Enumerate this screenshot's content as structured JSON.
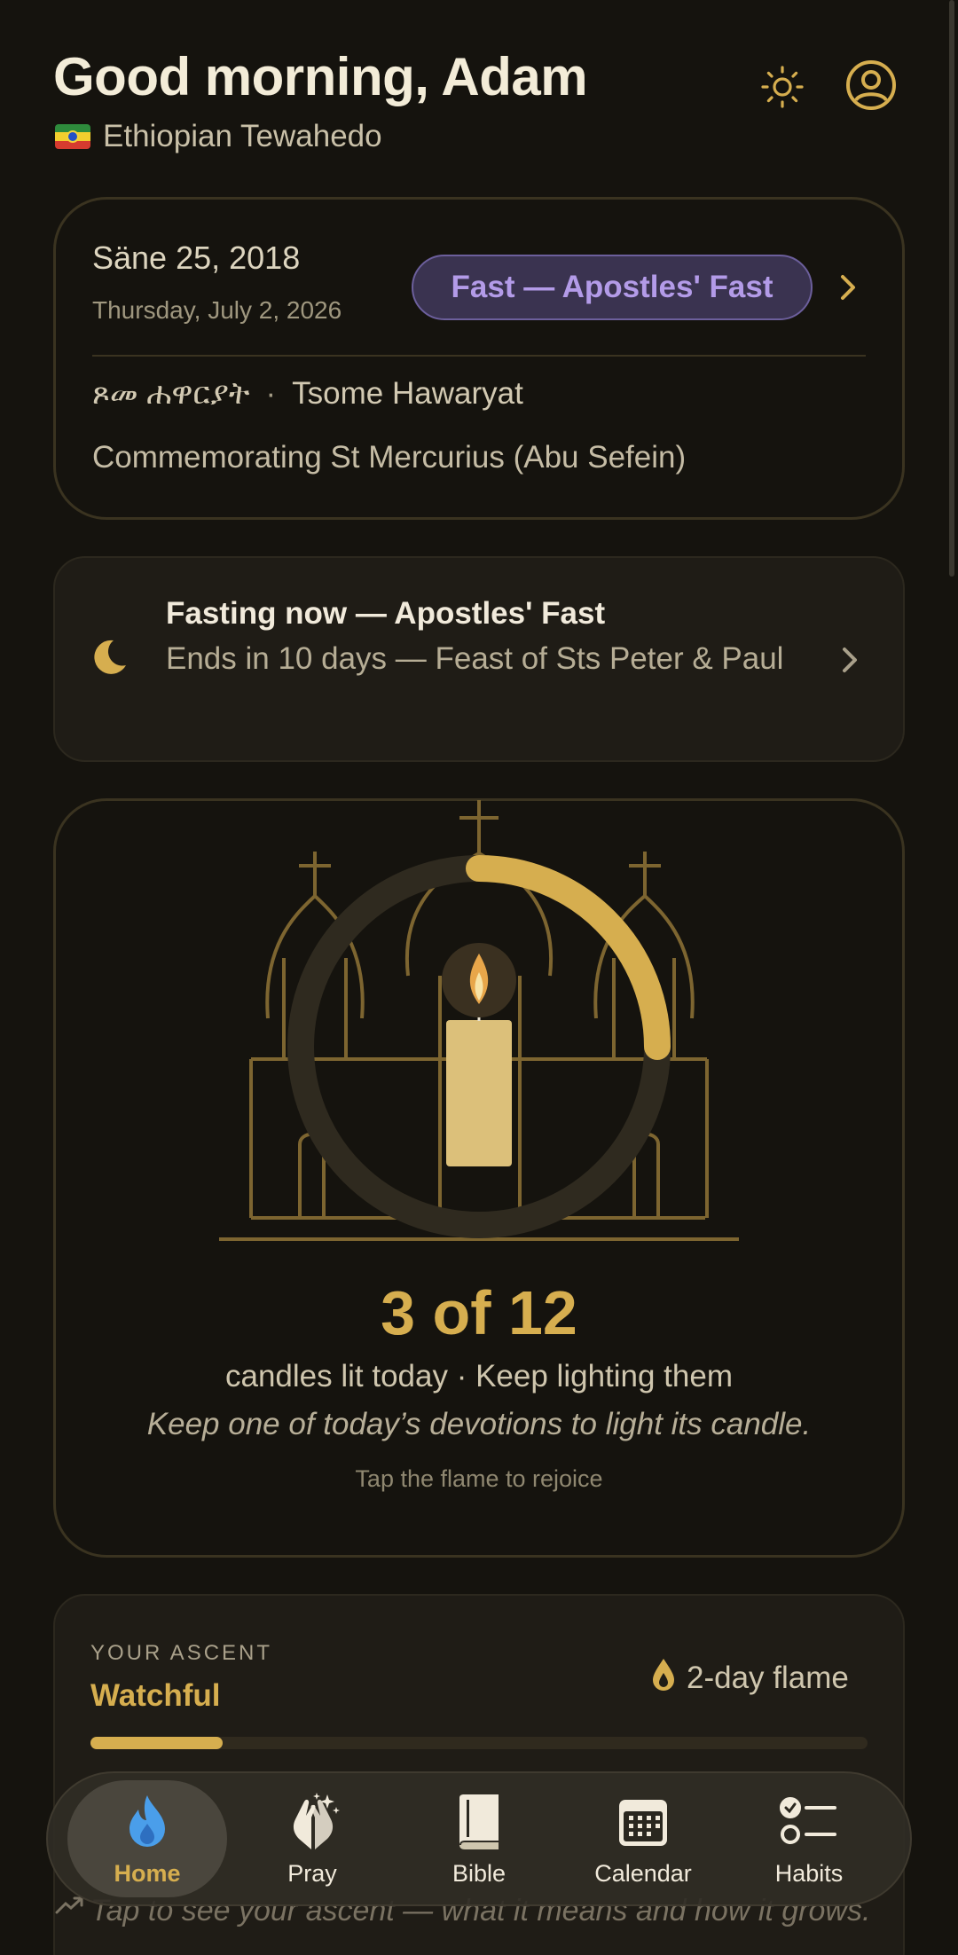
{
  "header": {
    "greeting": "Good morning, Adam",
    "tradition": "Ethiopian Tewahedo",
    "icons": [
      "sun-icon",
      "account-icon"
    ]
  },
  "date_card": {
    "ethiopian_date": "Säne 25, 2018",
    "gregorian_date": "Thursday, July 2, 2026",
    "fast_badge": "Fast — Apostles' Fast",
    "geez_name": "ጾመ ሐዋርያት",
    "separator": "·",
    "transliteration": "Tsome Hawaryat",
    "commemoration": "Commemorating St Mercurius (Abu Sefein)"
  },
  "fasting_card": {
    "title": "Fasting now — Apostles' Fast",
    "subtitle": "Ends in 10 days — Feast of Sts Peter & Paul"
  },
  "candle_card": {
    "count_text": "3 of 12",
    "candles_lit": 3,
    "candles_total": 12,
    "status": "candles lit today · Keep lighting them",
    "instruction": "Keep one of today’s devotions to light its candle.",
    "hint": "Tap the flame to rejoice"
  },
  "ascent_card": {
    "label": "YOUR ASCENT",
    "level": "Watchful",
    "streak": "2-day flame",
    "progress_fraction": 0.17,
    "hint": "Tap to see your ascent — what it means and how it grows."
  },
  "tabs": [
    {
      "label": "Home",
      "icon": "flame-icon",
      "active": true
    },
    {
      "label": "Pray",
      "icon": "praying-hands-icon",
      "active": false
    },
    {
      "label": "Bible",
      "icon": "book-icon",
      "active": false
    },
    {
      "label": "Calendar",
      "icon": "calendar-icon",
      "active": false
    },
    {
      "label": "Habits",
      "icon": "checklist-icon",
      "active": false
    }
  ],
  "colors": {
    "background": "#15130e",
    "accent_gold": "#d6ae4f",
    "fast_purple": "#b39be8",
    "home_flame_blue": "#4a9eea"
  }
}
